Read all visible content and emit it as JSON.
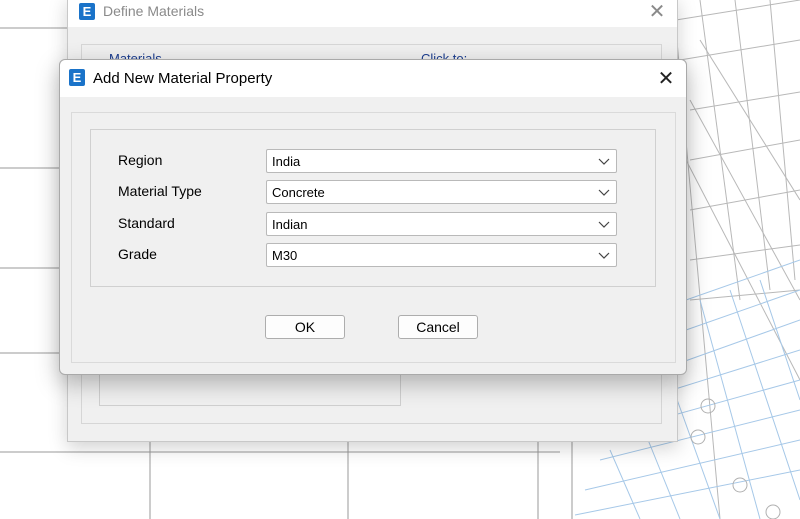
{
  "parent_dialog": {
    "title": "Define Materials",
    "header_left": "Materials",
    "header_right": "Click to:"
  },
  "dialog": {
    "title": "Add New Material Property",
    "fields": [
      {
        "label": "Region",
        "value": "India"
      },
      {
        "label": "Material Type",
        "value": "Concrete"
      },
      {
        "label": "Standard",
        "value": "Indian"
      },
      {
        "label": "Grade",
        "value": "M30"
      }
    ],
    "ok_label": "OK",
    "cancel_label": "Cancel"
  },
  "icons": {
    "app_logo": "E",
    "close": "close-icon",
    "dropdown": "chevron-down-icon"
  },
  "colors": {
    "accent": "#1a73c9",
    "dialog_bg": "#f0f0f0",
    "grid_line": "#a6c8e8"
  }
}
